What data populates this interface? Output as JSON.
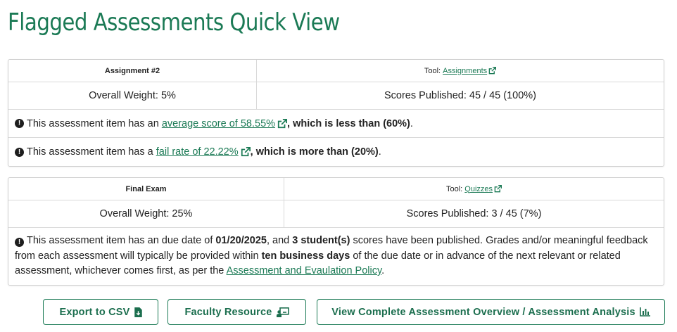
{
  "page": {
    "title": "Flagged Assessments Quick View"
  },
  "assessments": [
    {
      "name": "Assignment #2",
      "tool_prefix": "Tool:",
      "tool_link": "Assignments",
      "weight": "Overall Weight: 5%",
      "published": "Scores Published: 45 / 45 (100%)",
      "flags": [
        {
          "pre": "This assessment item has an ",
          "link": "average score of 58.55%",
          "post_bold": ", which is less than (60%)",
          "end": "."
        },
        {
          "pre": "This assessment item has a ",
          "link": "fail rate of 22.22%",
          "post_bold": ", which is more than (20%)",
          "end": "."
        }
      ]
    },
    {
      "name": "Final Exam",
      "tool_prefix": "Tool:",
      "tool_link": "Quizzes",
      "weight": "Overall Weight: 25%",
      "published": "Scores Published: 3 / 45 (7%)",
      "notice": {
        "t1": "This assessment item has an due date of ",
        "date": "01/20/2025",
        "t2": ", and ",
        "count": "3 student(s)",
        "t3": " scores have been published. Grades and/or meaningful feedback from each assessment will typically be provided within ",
        "days": "ten business days",
        "t4": " of the due date or in advance of the next relevant or related assessment, whichever comes first, as per the ",
        "policy_link": "Assessment and Evaulation Policy",
        "t5": "."
      }
    }
  ],
  "actions": {
    "export_csv": "Export to CSV",
    "faculty_resource": "Faculty Resource",
    "view_overview": "View Complete Assessment Overview / Assessment Analysis"
  },
  "icons": {
    "alert": "exclamation-circle-icon",
    "external": "external-link-icon",
    "download": "file-download-icon",
    "resource": "chalkboard-user-icon",
    "analysis": "bar-chart-icon"
  },
  "colors": {
    "accent": "#1b7a55",
    "text": "#222222",
    "border": "#d9d9d9"
  }
}
